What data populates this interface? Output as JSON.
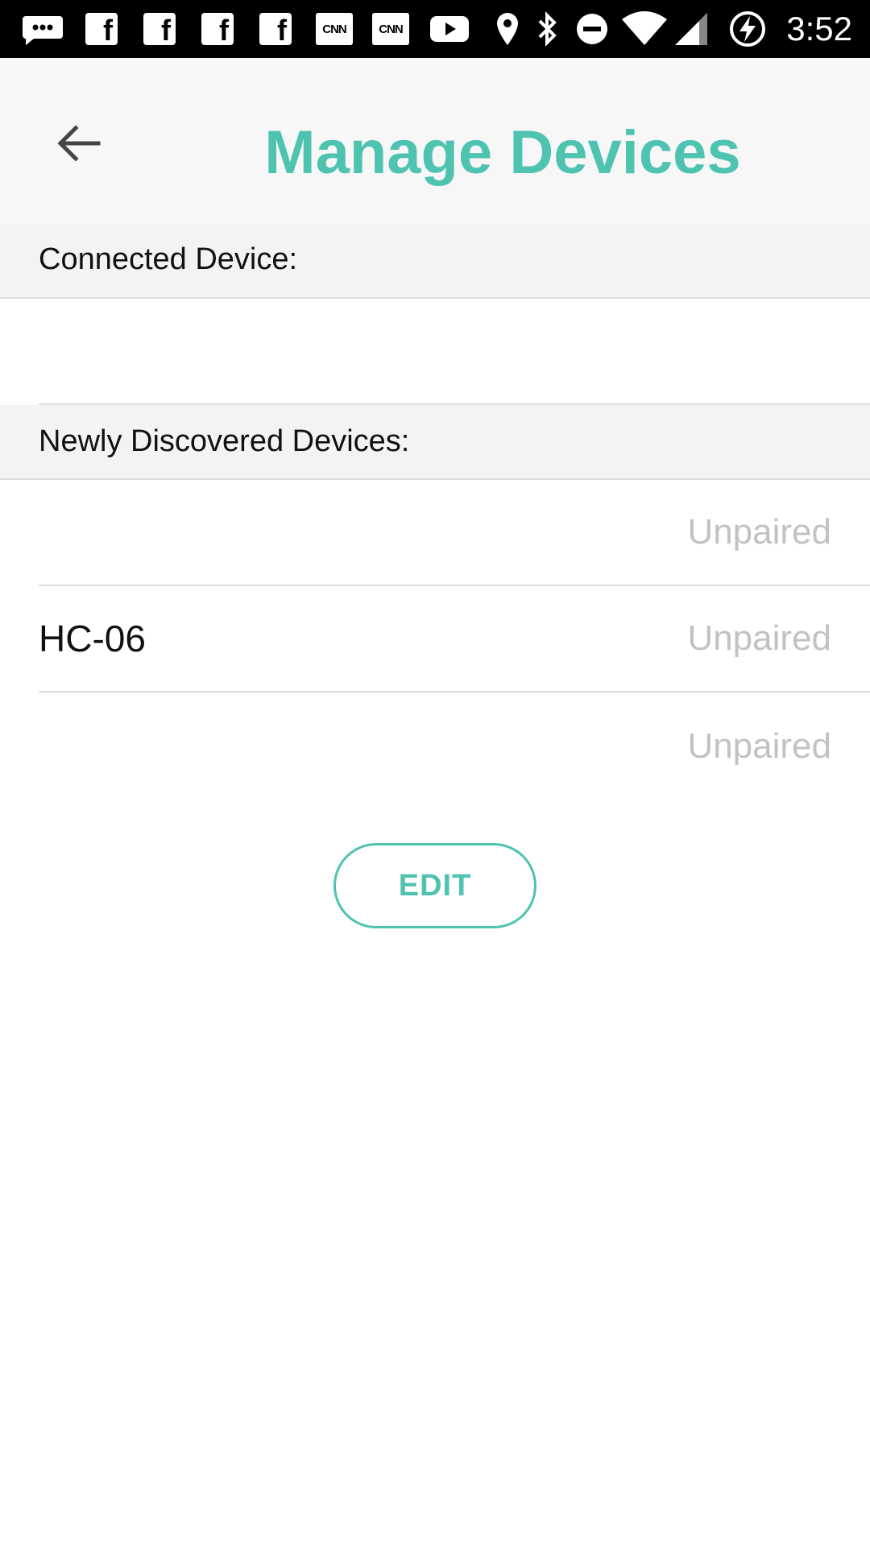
{
  "status_bar": {
    "time": "3:52",
    "icons": [
      "messenger-icon",
      "facebook-icon",
      "facebook-icon",
      "facebook-icon",
      "facebook-icon",
      "cnn-icon",
      "cnn-icon",
      "youtube-icon",
      "location-icon",
      "bluetooth-icon",
      "do-not-disturb-icon",
      "wifi-icon",
      "signal-icon",
      "battery-charging-icon"
    ],
    "cnn_label": "CNN",
    "fb_label": "f"
  },
  "app_bar": {
    "title": "Manage Devices",
    "back_icon": "arrow-back-icon"
  },
  "sections": {
    "connected": {
      "header": "Connected Device:"
    },
    "discovered": {
      "header": "Newly Discovered Devices:",
      "devices": [
        {
          "name": "",
          "status": "Unpaired"
        },
        {
          "name": "HC-06",
          "status": "Unpaired"
        },
        {
          "name": "",
          "status": "Unpaired"
        }
      ]
    }
  },
  "edit_button": {
    "label": "EDIT"
  },
  "colors": {
    "accent": "#4ec3b0",
    "status_text": "#c2c2c2",
    "header_bg": "#f3f3f3"
  }
}
